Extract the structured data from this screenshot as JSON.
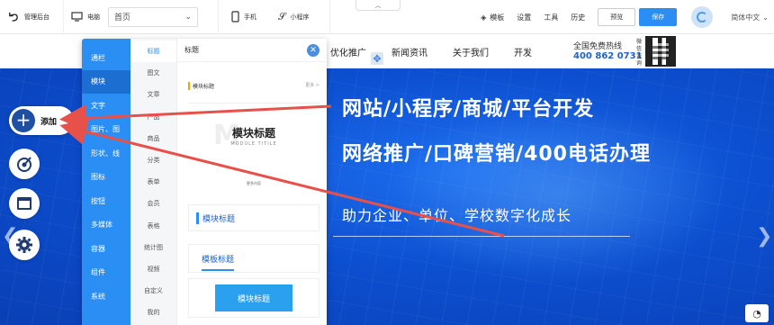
{
  "topbar": {
    "back_label": "管理后台",
    "device_pc": "电脑",
    "page_select": "首页",
    "device_mobile": "手机",
    "device_miniapp": "小程序",
    "collapse_icon": "chevron-up-icon",
    "template_label": "模板",
    "settings_label": "设置",
    "tools_label": "工具",
    "history_label": "历史",
    "preview_label": "预览",
    "save_label": "保存",
    "language_label": "简体中文"
  },
  "site_nav": {
    "items": [
      "优化推广",
      "新闻资讯",
      "关于我们",
      "开发"
    ],
    "hotline_label": "全国免费热线",
    "hotline_number": "400 862 0731",
    "qr_label": "微信咨询"
  },
  "banner": {
    "headline1": "网站/小程序/商城/平台开发",
    "headline2": "网络推广/口碑营销/400电话办理",
    "subline": "助力企业、单位、学校数字化成长",
    "color_primary": "#0c4fd0"
  },
  "tools": {
    "add_label": "添加"
  },
  "panel": {
    "categories": [
      "通栏",
      "模块",
      "文字",
      "图片、图",
      "形状、线",
      "图标",
      "按钮",
      "多媒体",
      "容器",
      "组件",
      "系统"
    ],
    "subcategories": [
      "标题",
      "图文",
      "文章",
      "产品",
      "商品",
      "分类",
      "表单",
      "会员",
      "表格",
      "统计图",
      "视频",
      "自定义",
      "我的"
    ],
    "preview_title": "标题",
    "preview_items": {
      "item1_title": "模块标题",
      "item1_more": "更多 >",
      "item2_title": "模块标题",
      "item2_en": "MODULE TITILE",
      "item2_ghost": "M",
      "item2_more": "更多内容",
      "item3_title": "模块标题",
      "item4_title": "模板标题",
      "item5_title": "模块标题"
    }
  },
  "colors": {
    "accent": "#2b8ef5",
    "annotation": "#e8504a"
  }
}
